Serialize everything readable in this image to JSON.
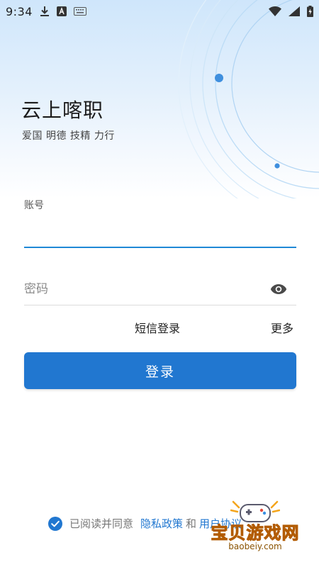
{
  "status_bar": {
    "time": "9:34",
    "left_icons": [
      "download-icon",
      "text-a-icon",
      "keyboard-icon"
    ],
    "right_icons": [
      "wifi-icon",
      "signal-icon",
      "battery-charging-icon"
    ]
  },
  "header": {
    "title": "云上喀职",
    "slogan": "爱国 明德 技精 力行"
  },
  "form": {
    "account_label": "账号",
    "account_value": "",
    "password_placeholder": "密码",
    "password_value": "",
    "sms_login_label": "短信登录",
    "more_label": "更多",
    "login_button_label": "登录"
  },
  "agreement": {
    "checked": true,
    "prefix": "已阅读并同意",
    "privacy_link": "隐私政策",
    "and_text": "和",
    "user_link": "用户协议"
  },
  "watermark": {
    "name": "宝贝游戏网",
    "url": "baobeiy.com"
  },
  "colors": {
    "accent": "#2177d0",
    "underline_active": "#1f88d6",
    "header_top": "#cfe6fb",
    "watermark": "#f4a51c"
  }
}
